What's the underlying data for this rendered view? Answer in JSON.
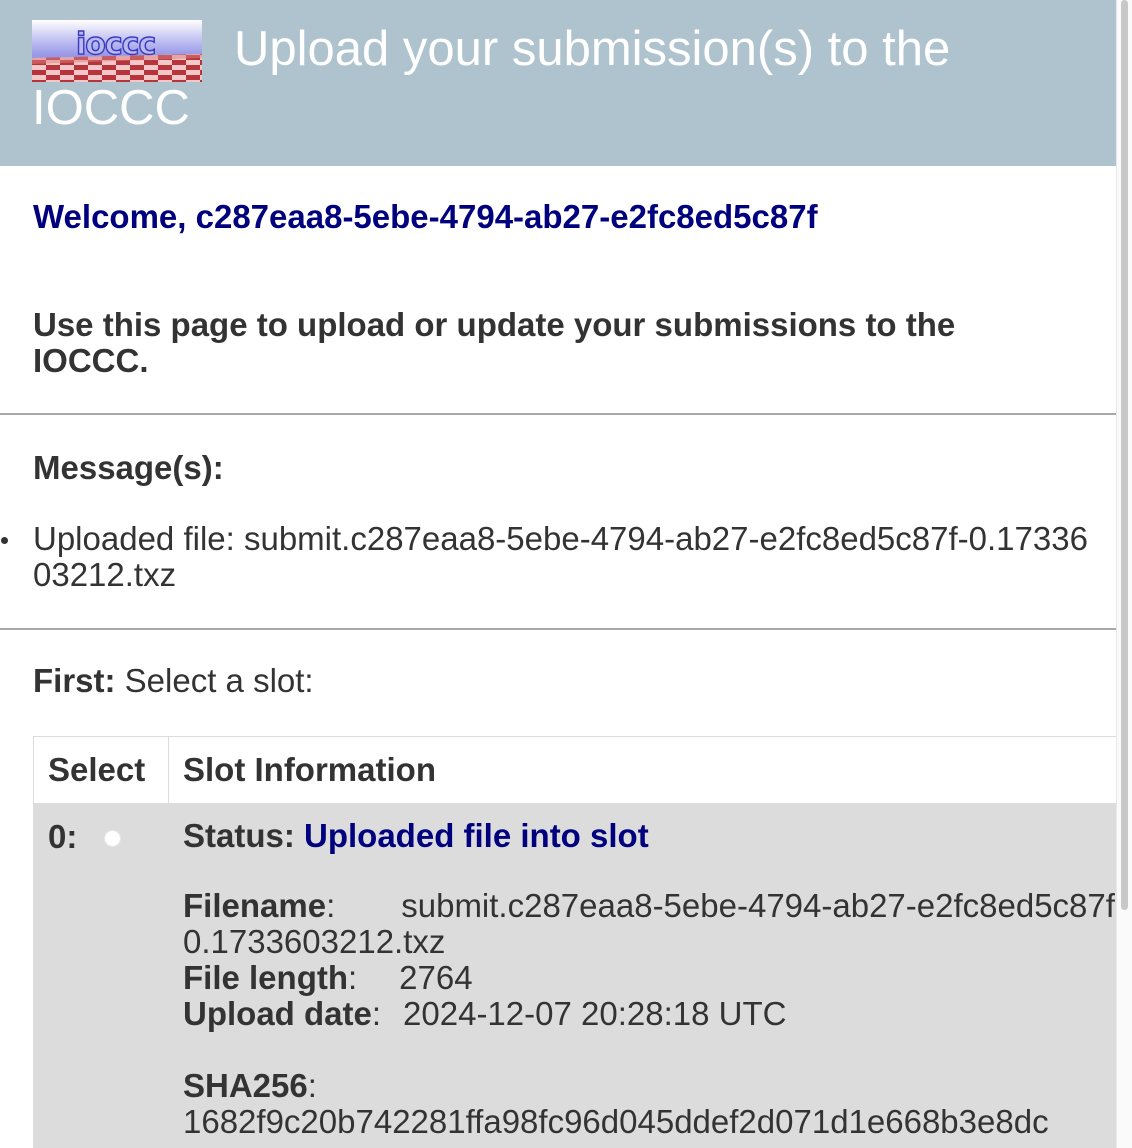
{
  "header": {
    "logo_text": "ioccc",
    "title": "Upload your submission(s) to the IOCCC"
  },
  "welcome": "Welcome, c287eaa8-5ebe-4794-ab27-e2fc8ed5c87f",
  "intro": "Use this page to upload or update your submissions to the IOCCC.",
  "messages": {
    "heading": "Message(s):",
    "items": [
      "Uploaded file: submit.c287eaa8-5ebe-4794-ab27-e2fc8ed5c87f-0.1733603212.txz"
    ]
  },
  "slot_select": {
    "first_label": "First:",
    "first_text": "Select a slot:",
    "columns": [
      "Select",
      "Slot Information"
    ],
    "rows": [
      {
        "slot": "0:",
        "status_label": "Status:",
        "status_value": "Uploaded file into slot",
        "filename_label": "Filename",
        "filename_value": "submit.c287eaa8-5ebe-4794-ab27-e2fc8ed5c87f-",
        "filename_value_cont": "0.1733603212.txz",
        "length_label": "File length",
        "length_value": "2764",
        "date_label": "Upload date",
        "date_value": "2024-12-07 20:28:18 UTC",
        "sha_label": "SHA256",
        "sha_value": "1682f9c20b742281ffa98fc96d045ddef2d071d1e668b3e8dc"
      }
    ]
  },
  "colors": {
    "header_bg": "#afc3ce",
    "accent_navy": "#00007f",
    "row_bg": "#dcdcdc"
  }
}
